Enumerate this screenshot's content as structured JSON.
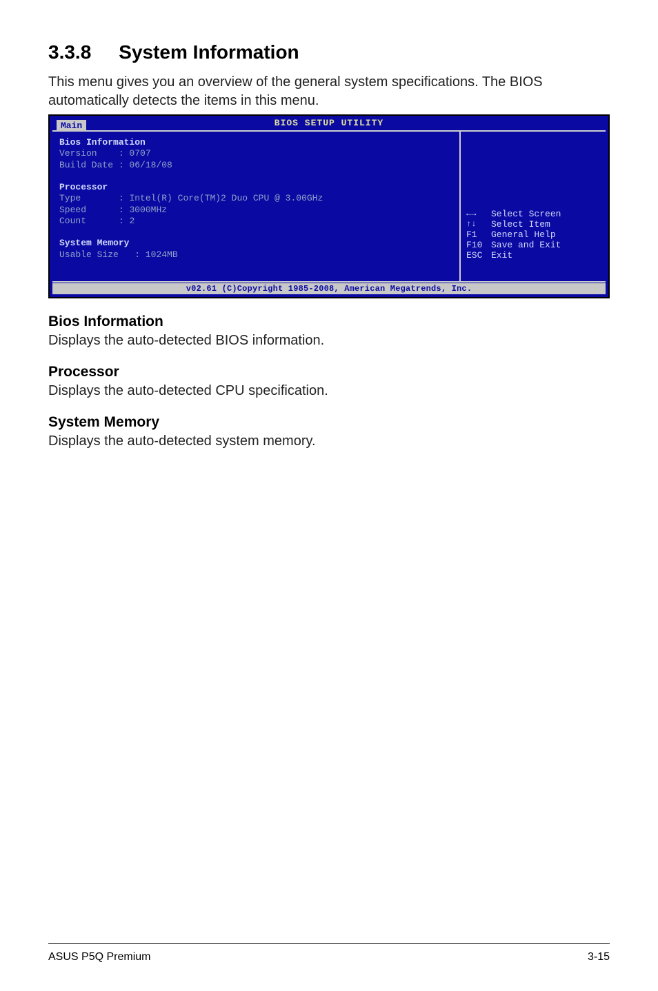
{
  "section": {
    "number": "3.3.8",
    "title": "System Information"
  },
  "intro": "This menu gives you an overview of the general system specifications. The BIOS automatically detects the items in this menu.",
  "bios": {
    "title": "BIOS SETUP UTILITY",
    "tab": "Main",
    "info_header": "Bios Information",
    "version_label": "Version",
    "version_value": "0707",
    "build_label": "Build Date",
    "build_value": "06/18/08",
    "proc_header": "Processor",
    "type_label": "Type",
    "type_value": "Intel(R) Core(TM)2 Duo CPU @ 3.00GHz",
    "speed_label": "Speed",
    "speed_value": "3000MHz",
    "count_label": "Count",
    "count_value": "2",
    "mem_header": "System Memory",
    "usable_label": "Usable Size",
    "usable_value": "1024MB",
    "help": {
      "select_screen": "Select Screen",
      "select_item": "Select Item",
      "f1_key": "F1",
      "f1_text": "General Help",
      "f10_key": "F10",
      "f10_text": "Save and Exit",
      "esc_key": "ESC",
      "esc_text": "Exit"
    },
    "footer": "v02.61 (C)Copyright 1985-2008, American Megatrends, Inc."
  },
  "sections": {
    "bios_info_h": "Bios Information",
    "bios_info_t": "Displays the auto-detected BIOS information.",
    "proc_h": "Processor",
    "proc_t": "Displays the auto-detected CPU specification.",
    "mem_h": "System Memory",
    "mem_t": "Displays the auto-detected system memory."
  },
  "footer": {
    "left": "ASUS P5Q Premium",
    "right": "3-15"
  }
}
